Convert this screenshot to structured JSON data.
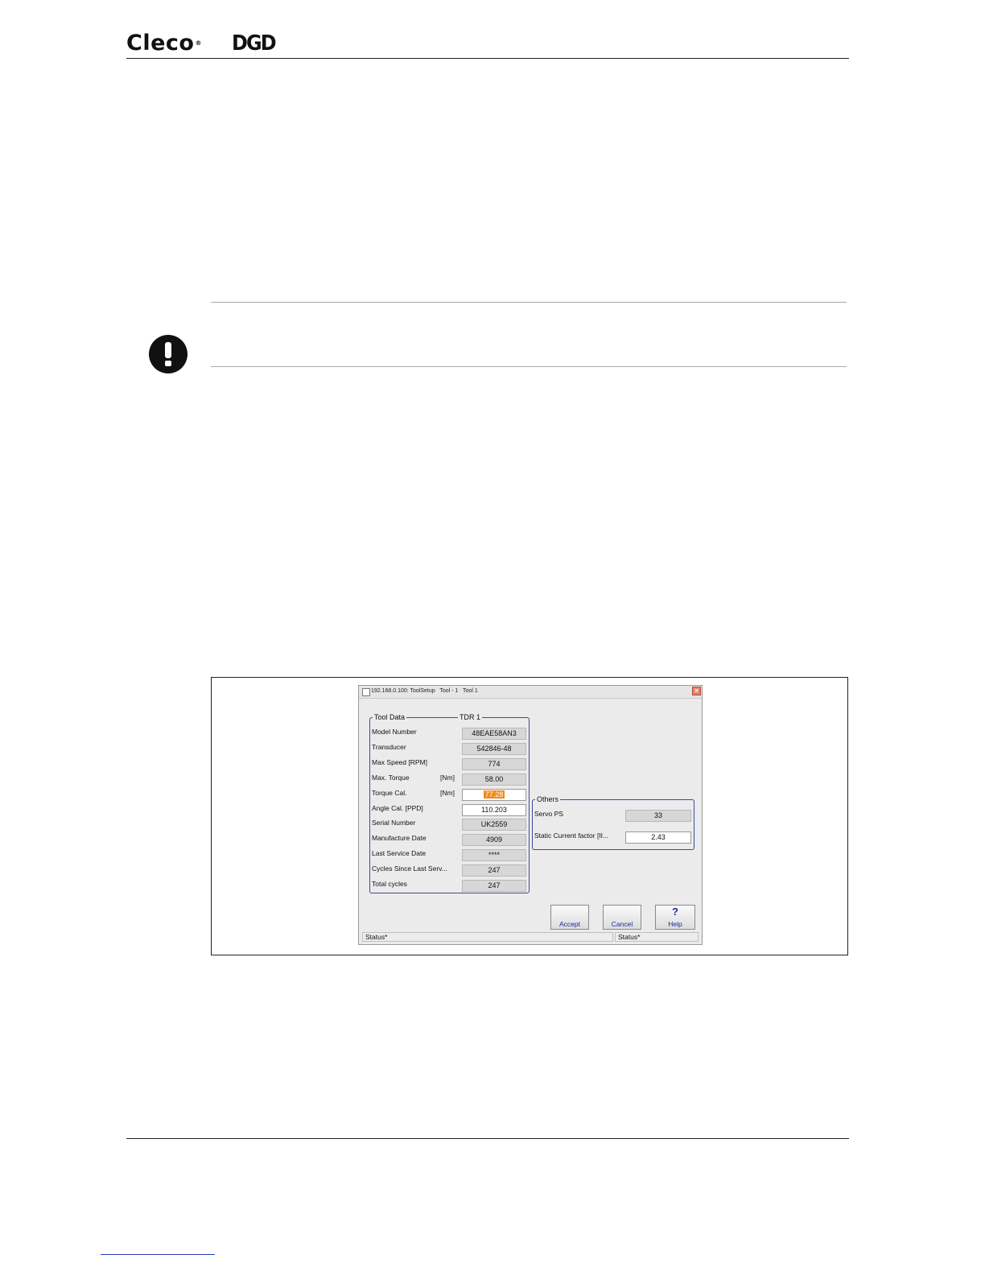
{
  "header": {
    "brand_primary": "Cleco",
    "brand_mark": "®",
    "brand_secondary": "DGD"
  },
  "dialog": {
    "title": "192.168.0.100: ToolSetup   Tool - 1   Tool 1",
    "close_symbol": "×",
    "tool_data": {
      "legend": "Tool Data",
      "tool_name": "TDR 1",
      "rows": [
        {
          "label": "Model Number",
          "unit": "",
          "value": "48EAE58AN3",
          "editable": false
        },
        {
          "label": "Transducer",
          "unit": "",
          "value": "542846-48",
          "editable": false
        },
        {
          "label": "Max Speed [RPM]",
          "unit": "",
          "value": "774",
          "editable": false
        },
        {
          "label": "Max. Torque",
          "unit": "[Nm]",
          "value": "58.00",
          "editable": false
        },
        {
          "label": "Torque Cal.",
          "unit": "[Nm]",
          "value": "77.28",
          "editable": true
        },
        {
          "label": "Angle Cal. [PPD]",
          "unit": "",
          "value": "110.203",
          "editable": true
        },
        {
          "label": "Serial Number",
          "unit": "",
          "value": "UK2559",
          "editable": false
        },
        {
          "label": "Manufacture Date",
          "unit": "",
          "value": "4909",
          "editable": false
        },
        {
          "label": "Last Service Date",
          "unit": "",
          "value": "****",
          "editable": false
        },
        {
          "label": "Cycles Since Last Serv...",
          "unit": "",
          "value": "247",
          "editable": false
        },
        {
          "label": "Total cycles",
          "unit": "",
          "value": "247",
          "editable": false
        }
      ]
    },
    "others": {
      "legend": "Others",
      "rows": [
        {
          "label": "Servo PS",
          "value": "33",
          "editable": false
        },
        {
          "label": "Static Current factor [II...",
          "value": "2.43",
          "editable": true
        }
      ]
    },
    "buttons": {
      "accept": "Accept",
      "cancel": "Cancel",
      "help": "Help",
      "help_symbol": "?"
    },
    "status": {
      "left": "Status*",
      "right": "Status*"
    }
  }
}
